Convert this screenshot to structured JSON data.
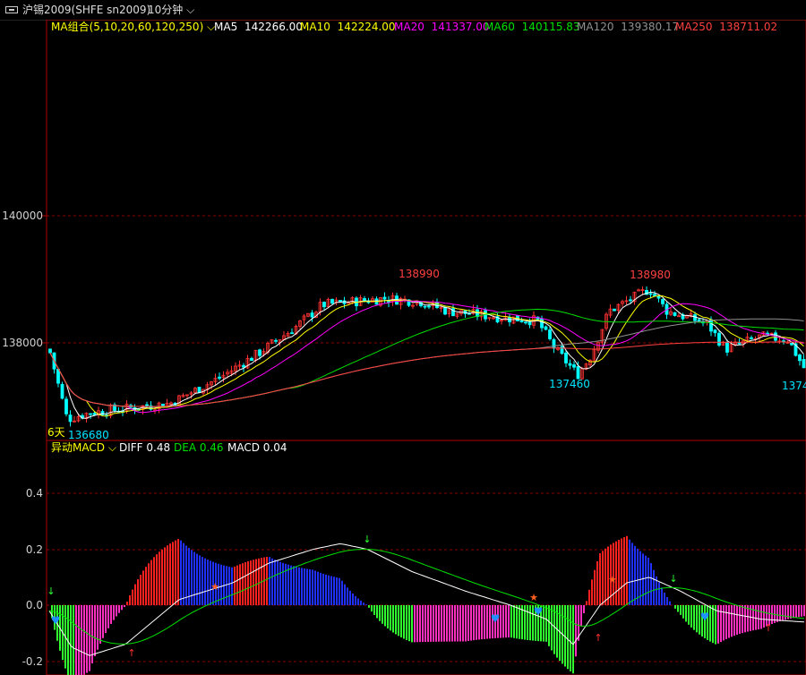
{
  "header": {
    "symbol": "沪锡2009(SHFE sn2009)",
    "period": "10分钟"
  },
  "price_panel": {
    "ma_group_label": "MA组合(5,10,20,60,120,250)",
    "ma_legend": [
      {
        "label": "MA5",
        "value": "142266.00",
        "color": "#ffffff"
      },
      {
        "label": "MA10",
        "value": "142224.00",
        "color": "#ffff00"
      },
      {
        "label": "MA20",
        "value": "141337.00",
        "color": "#ff00ff"
      },
      {
        "label": "MA60",
        "value": "140115.83",
        "color": "#00e000"
      },
      {
        "label": "MA120",
        "value": "139380.17",
        "color": "#909090"
      },
      {
        "label": "MA250",
        "value": "138711.02",
        "color": "#ff4040"
      }
    ],
    "y_ticks": [
      "140000",
      "138000"
    ],
    "annotations": {
      "h1": "138990",
      "h2": "138980",
      "l1": "136680",
      "l2": "137460",
      "l3": "1374"
    },
    "days_label": "6天"
  },
  "macd_panel": {
    "label": "异动MACD",
    "diff": "DIFF 0.48",
    "dea": "DEA 0.46",
    "macd": "MACD 0.04",
    "y_ticks": [
      "0.4",
      "0.2",
      "0.0",
      "-0.2"
    ]
  },
  "colors": {
    "up": "#ff3232",
    "down": "#00ffff",
    "grid": "#8b0000",
    "axis": "#b00000"
  },
  "chart_data": [
    {
      "type": "candlestick",
      "title": "沪锡2009(SHFE sn2009) 10分钟",
      "y_ticks": [
        140000,
        138000
      ],
      "highs": [
        138990,
        138980
      ],
      "lows": [
        136680,
        137460
      ],
      "ma_values": {
        "MA5": 142266.0,
        "MA10": 142224.0,
        "MA20": 141337.0,
        "MA60": 140115.83,
        "MA120": 139380.17,
        "MA250": 138711.02
      }
    },
    {
      "type": "line",
      "title": "异动MACD",
      "y_ticks": [
        0.4,
        0.2,
        0.0,
        -0.2
      ],
      "series": [
        {
          "name": "DIFF",
          "values": [
            0.48
          ]
        },
        {
          "name": "DEA",
          "values": [
            0.46
          ]
        },
        {
          "name": "MACD",
          "values": [
            0.04
          ]
        }
      ]
    }
  ]
}
